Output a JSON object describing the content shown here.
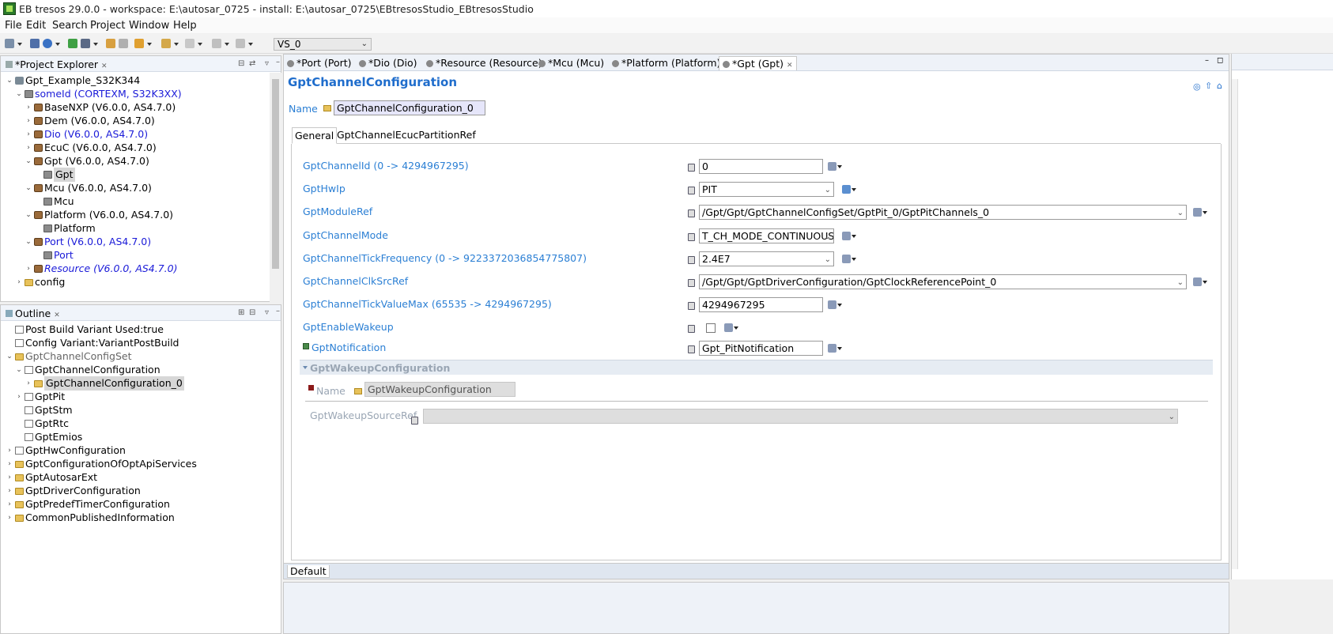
{
  "window": {
    "title": "EB tresos 29.0.0 - workspace: E:\\autosar_0725 - install: E:\\autosar_0725\\EBtresosStudio_EBtresosStudio"
  },
  "menu": [
    "File",
    "Edit",
    "Search",
    "Project",
    "Window",
    "Help"
  ],
  "toolbar": {
    "variant_select": "VS_0"
  },
  "project_explorer": {
    "title": "*Project Explorer",
    "items": [
      {
        "label": "Gpt_Example_S32K344",
        "level": 0,
        "twisty": "open",
        "icon": "project-icon"
      },
      {
        "label": "someId (CORTEXM, S32K3XX)",
        "level": 1,
        "twisty": "open",
        "icon": "config-icon",
        "style": "blue"
      },
      {
        "label": "BaseNXP (V6.0.0, AS4.7.0)",
        "level": 2,
        "twisty": "closed",
        "icon": "module-icon"
      },
      {
        "label": "Dem (V6.0.0, AS4.7.0)",
        "level": 2,
        "twisty": "closed",
        "icon": "module-icon"
      },
      {
        "label": "Dio (V6.0.0, AS4.7.0)",
        "level": 2,
        "twisty": "closed",
        "icon": "module-icon",
        "style": "blue"
      },
      {
        "label": "EcuC (V6.0.0, AS4.7.0)",
        "level": 2,
        "twisty": "closed",
        "icon": "module-icon"
      },
      {
        "label": "Gpt (V6.0.0, AS4.7.0)",
        "level": 2,
        "twisty": "open",
        "icon": "module-icon"
      },
      {
        "label": "Gpt",
        "level": 3,
        "twisty": "",
        "icon": "module-config-icon",
        "selected": true
      },
      {
        "label": "Mcu (V6.0.0, AS4.7.0)",
        "level": 2,
        "twisty": "open",
        "icon": "module-icon"
      },
      {
        "label": "Mcu",
        "level": 3,
        "twisty": "",
        "icon": "module-config-icon"
      },
      {
        "label": "Platform (V6.0.0, AS4.7.0)",
        "level": 2,
        "twisty": "open",
        "icon": "module-icon"
      },
      {
        "label": "Platform",
        "level": 3,
        "twisty": "",
        "icon": "module-config-icon"
      },
      {
        "label": "Port (V6.0.0, AS4.7.0)",
        "level": 2,
        "twisty": "open",
        "icon": "module-icon",
        "style": "blue"
      },
      {
        "label": "Port",
        "level": 3,
        "twisty": "",
        "icon": "module-config-icon",
        "style": "blue"
      },
      {
        "label": "Resource (V6.0.0, AS4.7.0)",
        "level": 2,
        "twisty": "closed",
        "icon": "module-icon",
        "style": "blue-italic"
      },
      {
        "label": "config",
        "level": 1,
        "twisty": "closed",
        "icon": "folder-icon"
      }
    ]
  },
  "outline": {
    "title": "Outline",
    "items": [
      {
        "label": "Post Build Variant Used:true",
        "level": 0,
        "twisty": "",
        "icon": "doc-icon"
      },
      {
        "label": "Config Variant:VariantPostBuild",
        "level": 0,
        "twisty": "",
        "icon": "doc-icon"
      },
      {
        "label": "GptChannelConfigSet",
        "level": 0,
        "twisty": "open",
        "icon": "folder-icon",
        "style": "gray"
      },
      {
        "label": "GptChannelConfiguration",
        "level": 1,
        "twisty": "open",
        "icon": "list-icon"
      },
      {
        "label": "GptChannelConfiguration_0",
        "level": 2,
        "twisty": "closed",
        "icon": "folder-icon",
        "selected": true
      },
      {
        "label": "GptPit",
        "level": 1,
        "twisty": "closed",
        "icon": "list-icon"
      },
      {
        "label": "GptStm",
        "level": 1,
        "twisty": "",
        "icon": "list-icon"
      },
      {
        "label": "GptRtc",
        "level": 1,
        "twisty": "",
        "icon": "list-icon"
      },
      {
        "label": "GptEmios",
        "level": 1,
        "twisty": "",
        "icon": "list-icon"
      },
      {
        "label": "GptHwConfiguration",
        "level": 0,
        "twisty": "closed",
        "icon": "list-icon"
      },
      {
        "label": "GptConfigurationOfOptApiServices",
        "level": 0,
        "twisty": "closed",
        "icon": "folder-icon"
      },
      {
        "label": "GptAutosarExt",
        "level": 0,
        "twisty": "closed",
        "icon": "folder-icon"
      },
      {
        "label": "GptDriverConfiguration",
        "level": 0,
        "twisty": "closed",
        "icon": "folder-icon"
      },
      {
        "label": "GptPredefTimerConfiguration",
        "level": 0,
        "twisty": "closed",
        "icon": "folder-icon"
      },
      {
        "label": "CommonPublishedInformation",
        "level": 0,
        "twisty": "closed",
        "icon": "folder-icon"
      }
    ]
  },
  "editor": {
    "tabs": [
      {
        "label": "*Port (Port)"
      },
      {
        "label": "*Dio (Dio)"
      },
      {
        "label": "*Resource (Resource)"
      },
      {
        "label": "*Mcu (Mcu)"
      },
      {
        "label": "*Platform (Platform)"
      },
      {
        "label": "*Gpt (Gpt)",
        "active": true
      }
    ],
    "title": "GptChannelConfiguration",
    "name_label": "Name",
    "name_value": "GptChannelConfiguration_0",
    "subtabs": [
      "General",
      "GptChannelEcucPartitionRef"
    ],
    "fields": [
      {
        "label": "GptChannelId (0 -> 4294967295)",
        "value": "0",
        "kind": "text"
      },
      {
        "label": "GptHwIp",
        "value": "PIT",
        "kind": "combo"
      },
      {
        "label": "GptModuleRef",
        "value": "/Gpt/Gpt/GptChannelConfigSet/GptPit_0/GptPitChannels_0",
        "kind": "combo-wide"
      },
      {
        "label": "GptChannelMode",
        "value": "T_CH_MODE_CONTINUOUS",
        "kind": "combo"
      },
      {
        "label": "GptChannelTickFrequency (0 -> 9223372036854775807)",
        "value": "2.4E7",
        "kind": "combo"
      },
      {
        "label": "GptChannelClkSrcRef",
        "value": "/Gpt/Gpt/GptDriverConfiguration/GptClockReferencePoint_0",
        "kind": "combo-wide"
      },
      {
        "label": "GptChannelTickValueMax (65535 -> 4294967295)",
        "value": "4294967295",
        "kind": "text"
      },
      {
        "label": "GptEnableWakeup",
        "value": "",
        "kind": "checkbox"
      },
      {
        "label": "GptNotification",
        "value": "Gpt_PitNotification",
        "kind": "text"
      }
    ],
    "wakeup": {
      "header": "GptWakeupConfiguration",
      "name_label": "Name",
      "name_value": "GptWakeupConfiguration",
      "source_ref_label": "GptWakeupSourceRef"
    },
    "bottom_tab": "Default"
  },
  "colors": {
    "accent": "#1f6dcc",
    "field_label": "#2b7fd4",
    "tree_blue": "#1a1ad8"
  }
}
